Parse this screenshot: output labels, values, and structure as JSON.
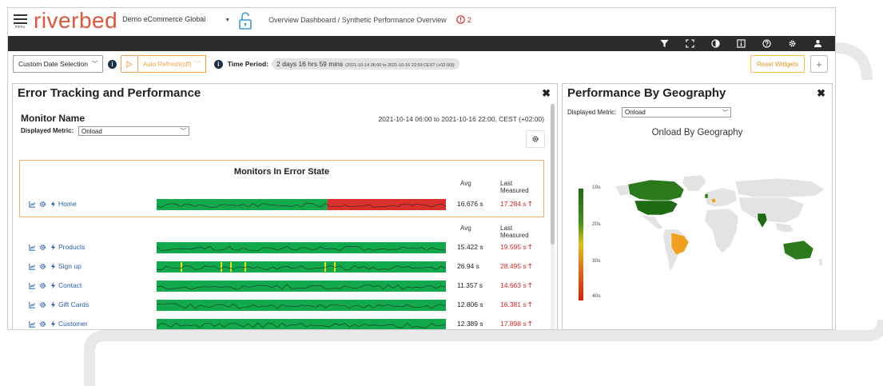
{
  "header": {
    "menu_label": "menu",
    "logo_text": "riverbed",
    "site_name": "Demo eCommerce Global",
    "breadcrumb": "Overview Dashboard / Synthetic Performance Overview",
    "alert_count": "2"
  },
  "toolbar_icons": [
    "filter-icon",
    "fullscreen-icon",
    "contrast-icon",
    "info-square-icon",
    "help-icon",
    "settings-icon",
    "user-icon"
  ],
  "controls": {
    "date_selection": "Custom Date Selection",
    "auto_refresh": "Auto Refresh(off)",
    "time_period_label": "Time Period:",
    "time_period_value": "2 days 16 hrs 59 mins",
    "time_period_range": "(2021-10-14 06:00 to 2021-10-16 22:59 CEST (+02:00))",
    "reset_widgets": "Reset Widgets",
    "add_label": "+"
  },
  "error_panel": {
    "title": "Error Tracking and Performance",
    "close": "✖",
    "monitor_name_label": "Monitor Name",
    "date_range": "2021-10-14 06:00 to 2021-10-16 22:00, CEST (+02:00)",
    "displayed_metric_label": "Displayed Metric:",
    "displayed_metric_value": "Onload",
    "error_state_title": "Monitors In Error State",
    "col_avg": "Avg",
    "col_last_1": "Last",
    "col_last_2": "Measured",
    "error_monitors": [
      {
        "name": "Home",
        "avg": "16.676 s",
        "last": "17.284 s",
        "trend": "up",
        "error_fraction": 0.59
      }
    ],
    "monitors": [
      {
        "name": "Products",
        "avg": "15.422 s",
        "last": "19.595 s",
        "trend": "up"
      },
      {
        "name": "Sign up",
        "avg": "26.94 s",
        "last": "28.495 s",
        "trend": "up"
      },
      {
        "name": "Contact",
        "avg": "11.357 s",
        "last": "14.663 s",
        "trend": "up"
      },
      {
        "name": "Gift Cards",
        "avg": "12.806 s",
        "last": "16.381 s",
        "trend": "up"
      },
      {
        "name": "Customer",
        "avg": "12.389 s",
        "last": "17.898 s",
        "trend": "up"
      }
    ]
  },
  "geo_panel": {
    "title": "Performance By Geography",
    "close": "✖",
    "displayed_metric_label": "Displayed Metric:",
    "displayed_metric_value": "Onload",
    "map_title": "Onload By Geography",
    "legend_ticks": [
      "10s",
      "20s",
      "30s",
      "40s"
    ],
    "colors": {
      "fast": "#1e6b14",
      "mid": "#e0c21a",
      "slow": "#d43a0a",
      "map_gray": "#e3e3e3",
      "australia": "#2c7a1c",
      "brazil": "#f0a020",
      "europe": "#e4a61c"
    }
  },
  "colors": {
    "accent": "#f3a24b",
    "link": "#2a5ea8",
    "error_red": "#d62828",
    "spark_green": "#12a84c",
    "spark_red": "#d9312b",
    "dark_bar": "#2b2b2b"
  }
}
